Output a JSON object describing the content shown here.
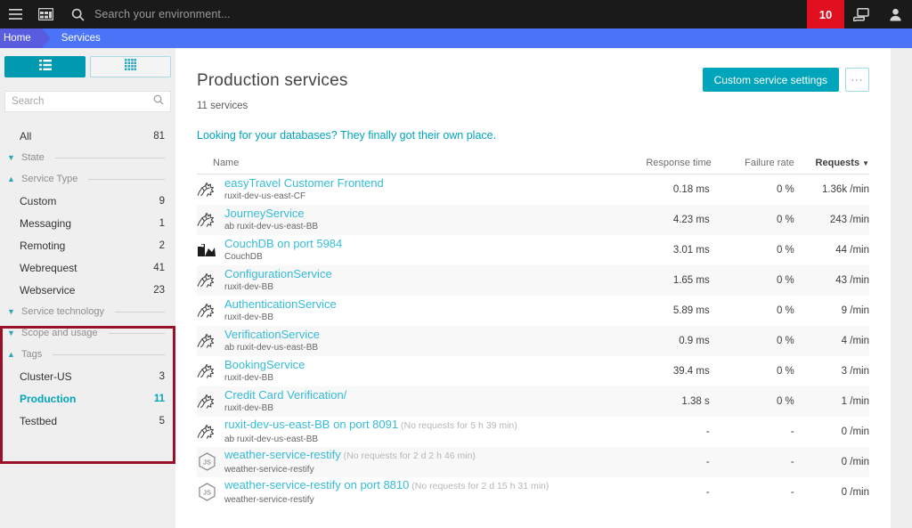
{
  "topbar": {
    "menu_icon": "hamburger-menu-icon",
    "apps_icon": "dashboard-grid-icon",
    "search_icon": "search-icon",
    "search_placeholder": "Search your environment...",
    "search_value": "",
    "badge_count": "10",
    "windows_icon": "windows-overlap-icon",
    "user_icon": "user-avatar-icon",
    "bar_color": "#1a1a1a",
    "badge_color": "#e01020"
  },
  "breadcrumb": {
    "home": "Home",
    "current": "Services",
    "bar_color": "#4b74f8",
    "home_color": "#5a5ce0"
  },
  "sidebar": {
    "view_toggle": {
      "list_label": "list-view",
      "grid_label": "grid-view",
      "active": "list-view",
      "active_color": "#009ab0"
    },
    "search": {
      "placeholder": "Search",
      "value": ""
    },
    "all": {
      "label": "All",
      "count": "81"
    },
    "groups": [
      {
        "title": "State",
        "expanded": false,
        "items": []
      },
      {
        "title": "Service Type",
        "expanded": true,
        "items": [
          {
            "label": "Custom",
            "count": "9",
            "selected": false
          },
          {
            "label": "Messaging",
            "count": "1",
            "selected": false
          },
          {
            "label": "Remoting",
            "count": "2",
            "selected": false
          },
          {
            "label": "Webrequest",
            "count": "41",
            "selected": false
          },
          {
            "label": "Webservice",
            "count": "23",
            "selected": false
          }
        ]
      },
      {
        "title": "Service technology",
        "expanded": false,
        "items": []
      },
      {
        "title": "Scope and usage",
        "expanded": false,
        "items": []
      },
      {
        "title": "Tags",
        "expanded": true,
        "items": [
          {
            "label": "Cluster-US",
            "count": "3",
            "selected": false
          },
          {
            "label": "Production",
            "count": "11",
            "selected": true
          },
          {
            "label": "Testbed",
            "count": "5",
            "selected": false
          }
        ]
      }
    ],
    "highlight_color": "#9b1028"
  },
  "main": {
    "title": "Production services",
    "service_count": "11 services",
    "info_link": "Looking for your databases? They finally got their own place.",
    "primary_button": "Custom service settings",
    "ellipsis_button": "···",
    "accent_color": "#00a5bb",
    "table": {
      "columns": [
        "Name",
        "Response time",
        "Failure rate",
        "Requests"
      ],
      "sorted_by": "Requests",
      "sort_direction": "desc",
      "rows": [
        {
          "icon": "java-service-icon",
          "name": "easyTravel Customer Frontend",
          "note": "",
          "sub": "ruxit-dev-us-east-CF",
          "response_time": "0.18 ms",
          "failure_rate": "0 %",
          "requests": "1.36k /min"
        },
        {
          "icon": "java-service-icon",
          "name": "JourneyService",
          "note": "",
          "sub": "ab ruxit-dev-us-east-BB",
          "response_time": "4.23 ms",
          "failure_rate": "0 %",
          "requests": "243 /min"
        },
        {
          "icon": "couchdb-icon",
          "name": "CouchDB on port 5984",
          "note": "",
          "sub": "CouchDB",
          "response_time": "3.01 ms",
          "failure_rate": "0 %",
          "requests": "44 /min"
        },
        {
          "icon": "java-service-icon",
          "name": "ConfigurationService",
          "note": "",
          "sub": "ruxit-dev-BB",
          "response_time": "1.65 ms",
          "failure_rate": "0 %",
          "requests": "43 /min"
        },
        {
          "icon": "java-service-icon",
          "name": "AuthenticationService",
          "note": "",
          "sub": "ruxit-dev-BB",
          "response_time": "5.89 ms",
          "failure_rate": "0 %",
          "requests": "9 /min"
        },
        {
          "icon": "java-service-icon",
          "name": "VerificationService",
          "note": "",
          "sub": "ab ruxit-dev-us-east-BB",
          "response_time": "0.9 ms",
          "failure_rate": "0 %",
          "requests": "4 /min"
        },
        {
          "icon": "java-service-icon",
          "name": "BookingService",
          "note": "",
          "sub": "ruxit-dev-BB",
          "response_time": "39.4 ms",
          "failure_rate": "0 %",
          "requests": "3 /min"
        },
        {
          "icon": "java-service-icon",
          "name": "Credit Card Verification/",
          "note": "",
          "sub": "ruxit-dev-BB",
          "response_time": "1.38 s",
          "failure_rate": "0 %",
          "requests": "1 /min"
        },
        {
          "icon": "java-service-icon",
          "name": "ruxit-dev-us-east-BB on port 8091",
          "note": "(No requests for 5 h 39 min)",
          "sub": "ab ruxit-dev-us-east-BB",
          "response_time": "-",
          "failure_rate": "-",
          "requests": "0 /min"
        },
        {
          "icon": "nodejs-icon",
          "name": "weather-service-restify",
          "note": "(No requests for 2 d 2 h 46 min)",
          "sub": "weather-service-restify",
          "response_time": "-",
          "failure_rate": "-",
          "requests": "0 /min"
        },
        {
          "icon": "nodejs-icon",
          "name": "weather-service-restify on port 8810",
          "note": "(No requests for 2 d 15 h 31 min)",
          "sub": "weather-service-restify",
          "response_time": "-",
          "failure_rate": "-",
          "requests": "0 /min"
        }
      ]
    }
  }
}
